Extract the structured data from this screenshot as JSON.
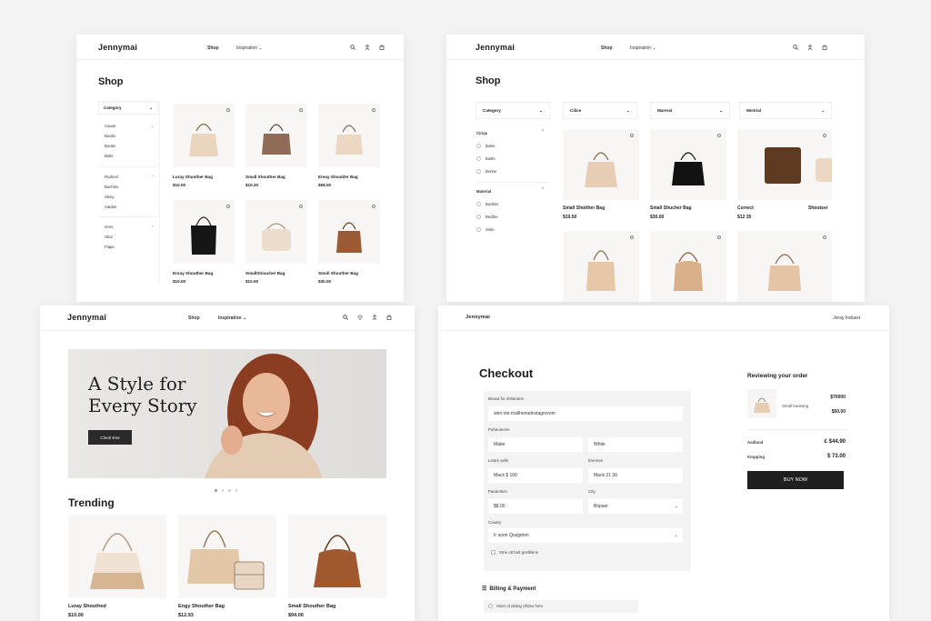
{
  "s1": {
    "brand": "Jennymai",
    "nav": [
      "Shop",
      "Inspiration ⌄"
    ],
    "title": "Shop",
    "category_label": "Category",
    "groups": [
      {
        "items": [
          "Cause",
          "Books",
          "Books",
          "Bolts"
        ]
      },
      {
        "items": [
          "Rudmel",
          "Bochine",
          "Skiny",
          "Aaidon"
        ]
      },
      {
        "items": [
          "Ores",
          "Shol",
          "Flaps"
        ]
      }
    ],
    "products": [
      {
        "name": "Luray Shouther Bag",
        "price": "$10.00"
      },
      {
        "name": "Small Shouther Bag",
        "price": "$10.20"
      },
      {
        "name": "Ereay Shoulder Bag",
        "price": "$58.00"
      },
      {
        "name": "Enray Shouther Bag",
        "price": "$10.00"
      },
      {
        "name": "SmallShoucher Bag",
        "price": "$10.00"
      },
      {
        "name": "Smoll Shouther Bag",
        "price": "$30.00"
      }
    ]
  },
  "s2": {
    "brand": "Jennymai",
    "nav": [
      "Shop",
      "Inspiration ⌄"
    ],
    "title": "Shop",
    "filters": [
      "Category",
      "Cilice",
      "Mareral",
      "Mistrial"
    ],
    "side_group1": "Ciriqs",
    "side_items1": [
      "Boiks",
      "Boilts",
      "Borker"
    ],
    "side_group2": "Material",
    "side_items2": [
      "Bodtins",
      "Bedthe",
      "Sstin"
    ],
    "products": [
      {
        "name": "Small Shotther Bag",
        "price": "$19.50"
      },
      {
        "name": "Small Shucher Bag",
        "price": "$30.00"
      },
      {
        "name": "Correct",
        "name2": "Shoutser",
        "price": "$12 35"
      }
    ]
  },
  "s3": {
    "brand": "Jennymai",
    "nav": [
      "Shop",
      "Inspiration ⌄"
    ],
    "hero_line1": "A Style for",
    "hero_line2": "Every Story",
    "hero_cta": "Cheol Ene",
    "trending_title": "Trending",
    "products": [
      {
        "name": "Luray Shouthed",
        "price": "$10.00"
      },
      {
        "name": "Engy Shouther Bag",
        "price": "$12.93"
      },
      {
        "name": "Small Shouther Bag",
        "price": "$94.00"
      }
    ]
  },
  "s4": {
    "brand": "Jennymai",
    "brand_right": "Jeray Indusst",
    "title": "Checkout",
    "email_label": "Bnaxd for dnlstrulon",
    "email_value": "slen ote.mallhemalnstagrovom",
    "fname_label": "Pohnuneme",
    "fname_value": "Mater",
    "lname_value": "White",
    "addr_label": "Lestre sells",
    "addr_value": "Mack $ 100",
    "exp_label": "Evenres",
    "exp_value": "Mack 21 30",
    "postal_label": "Paeamtien",
    "postal_value": "$8.00",
    "city_label": "City",
    "city_value": "Bopser",
    "country_label": "Couary",
    "country_value": "Ir uoon Qusgdom",
    "checkbox_label": "Strie ott bolt gnslklens",
    "billing_title": "Billing & Payment",
    "billing_option": "Stset of dsting cilldso hom",
    "review_title": "Reviewing your order",
    "review_item": "Small housnng",
    "review_price_top": "$70000",
    "review_price": "$50.00",
    "subtotal_label": "Aadland",
    "subtotal_value": "£ $44.90",
    "shipping_label": "Kmpping",
    "shipping_value": "$ 73.00",
    "buy_label": "BUY NOW"
  }
}
